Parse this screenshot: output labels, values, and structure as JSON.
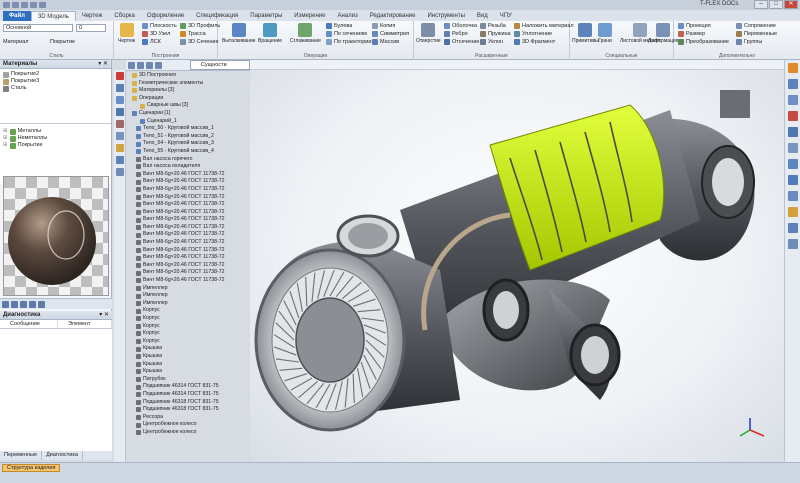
{
  "app": {
    "title": "T-FLEX DOCs"
  },
  "tabs": [
    "Файл",
    "3D Модель",
    "Чертеж",
    "Сборка",
    "Оформление",
    "Спецификация",
    "Параметры",
    "Измерение",
    "Анализ",
    "Редактирование",
    "Инструменты",
    "Вид",
    "ЧПУ"
  ],
  "ribbon": {
    "style_combo": "Основной",
    "material_label": "Материал",
    "coating_label": "Покрытие",
    "group_styles": "Стиль",
    "drawing_btn": "Чертеж",
    "plane": "Плоскость",
    "profile3d": "3D Профиль",
    "node3d": "3D Узел",
    "trace": "Трасса",
    "lsk": "ЛСК",
    "section3d": "3D Сечение",
    "group_build": "Построения",
    "extrude": "Выталкивание",
    "rotate": "Вращение",
    "smooth": "Сглаживание",
    "by_sections": "По сечениям",
    "by_trajectory": "По траектории",
    "boolean": "Булева",
    "symmetry": "Симметрия",
    "copy": "Копия",
    "array": "Массив",
    "group_ops": "Операции",
    "hole": "Отверстие",
    "shell": "Оболочка",
    "rib": "Ребро",
    "cut": "Отсечение",
    "thread": "Резьба",
    "spring": "Пружина",
    "tilt": "Уклон",
    "apply_material": "Наложить материал",
    "seal": "Уплотнение",
    "fragment3d": "3D Фрагмент",
    "group_ext": "Расширенные",
    "primitives": "Примитивы",
    "edges": "Грани",
    "sheet_metal": "Листовой металл",
    "deformation": "Деформация",
    "group_special": "Специальные",
    "projection": "Проекция",
    "size": "Размер",
    "transform": "Преобразование",
    "group_more": "Дополнительно",
    "mate": "Сопряжение",
    "variables": "Переменные",
    "groups": "Группы"
  },
  "left": {
    "materials_title": "Материалы",
    "materials": [
      "Покрытие2",
      "Покрытие3",
      "Сталь"
    ],
    "folders": [
      "Металлы",
      "Неметаллы",
      "Покрытие"
    ],
    "diag_title": "Диагностика",
    "diag_col_msg": "Сообщение",
    "diag_col_elem": "Элемент",
    "tab_variables": "Переменные",
    "tab_diag": "Диагностика"
  },
  "tree": {
    "doc_tab": "Сущности",
    "rows": [
      "3D Построения",
      "Геометрические элементы",
      "Материалы [3]",
      "Операции",
      "Сварные швы [3]",
      "Сценарии [1]",
      "Сценарий_1",
      "Тело_50 - Круговой массив_1",
      "Тело_51 - Круговой массив_2",
      "Тело_54 - Круговой массив_3",
      "Тело_55 - Круговой массив_4",
      "Вал насоса горячего",
      "Вал насоса охладителя",
      "Винт М8-6g×20.46 ГОСТ 11738-72",
      "Винт М8-6g×20.46 ГОСТ 11738-72",
      "Винт М8-6g×20.46 ГОСТ 11738-72",
      "Винт М8-6g×20.46 ГОСТ 11738-72",
      "Винт М8-6g×20.46 ГОСТ 11738-72",
      "Винт М8-6g×20.46 ГОСТ 11738-72",
      "Винт М8-6g×20.46 ГОСТ 11738-72",
      "Винт М8-6g×20.46 ГОСТ 11738-72",
      "Винт М8-6g×20.46 ГОСТ 11738-72",
      "Винт М8-6g×20.46 ГОСТ 11738-72",
      "Винт М8-6g×20.46 ГОСТ 11738-72",
      "Винт М8-6g×20.46 ГОСТ 11738-72",
      "Винт М8-6g×20.46 ГОСТ 11738-72",
      "Винт М8-6g×20.46 ГОСТ 11738-72",
      "Винт М8-6g×20.46 ГОСТ 11738-72",
      "Импеллер",
      "Импеллер",
      "Импеллер",
      "Корпус",
      "Корпус",
      "Корпус",
      "Корпус",
      "Корпус",
      "Крышка",
      "Крышка",
      "Крышка",
      "Крышка",
      "Патрубок",
      "Подшипник 46314 ГОСТ 831-75",
      "Подшипник 46314 ГОСТ 831-75",
      "Подшипник 46318 ГОСТ 831-75",
      "Подшипник 46318 ГОСТ 831-75",
      "Рессора",
      "Центробежное колесо",
      "Центробежное колесо"
    ]
  },
  "status": {
    "tab": "Структура изделия"
  },
  "colors": {
    "accent": "#2e6fbf",
    "highlight": "#c8f000",
    "metal": "#5a5c61"
  }
}
